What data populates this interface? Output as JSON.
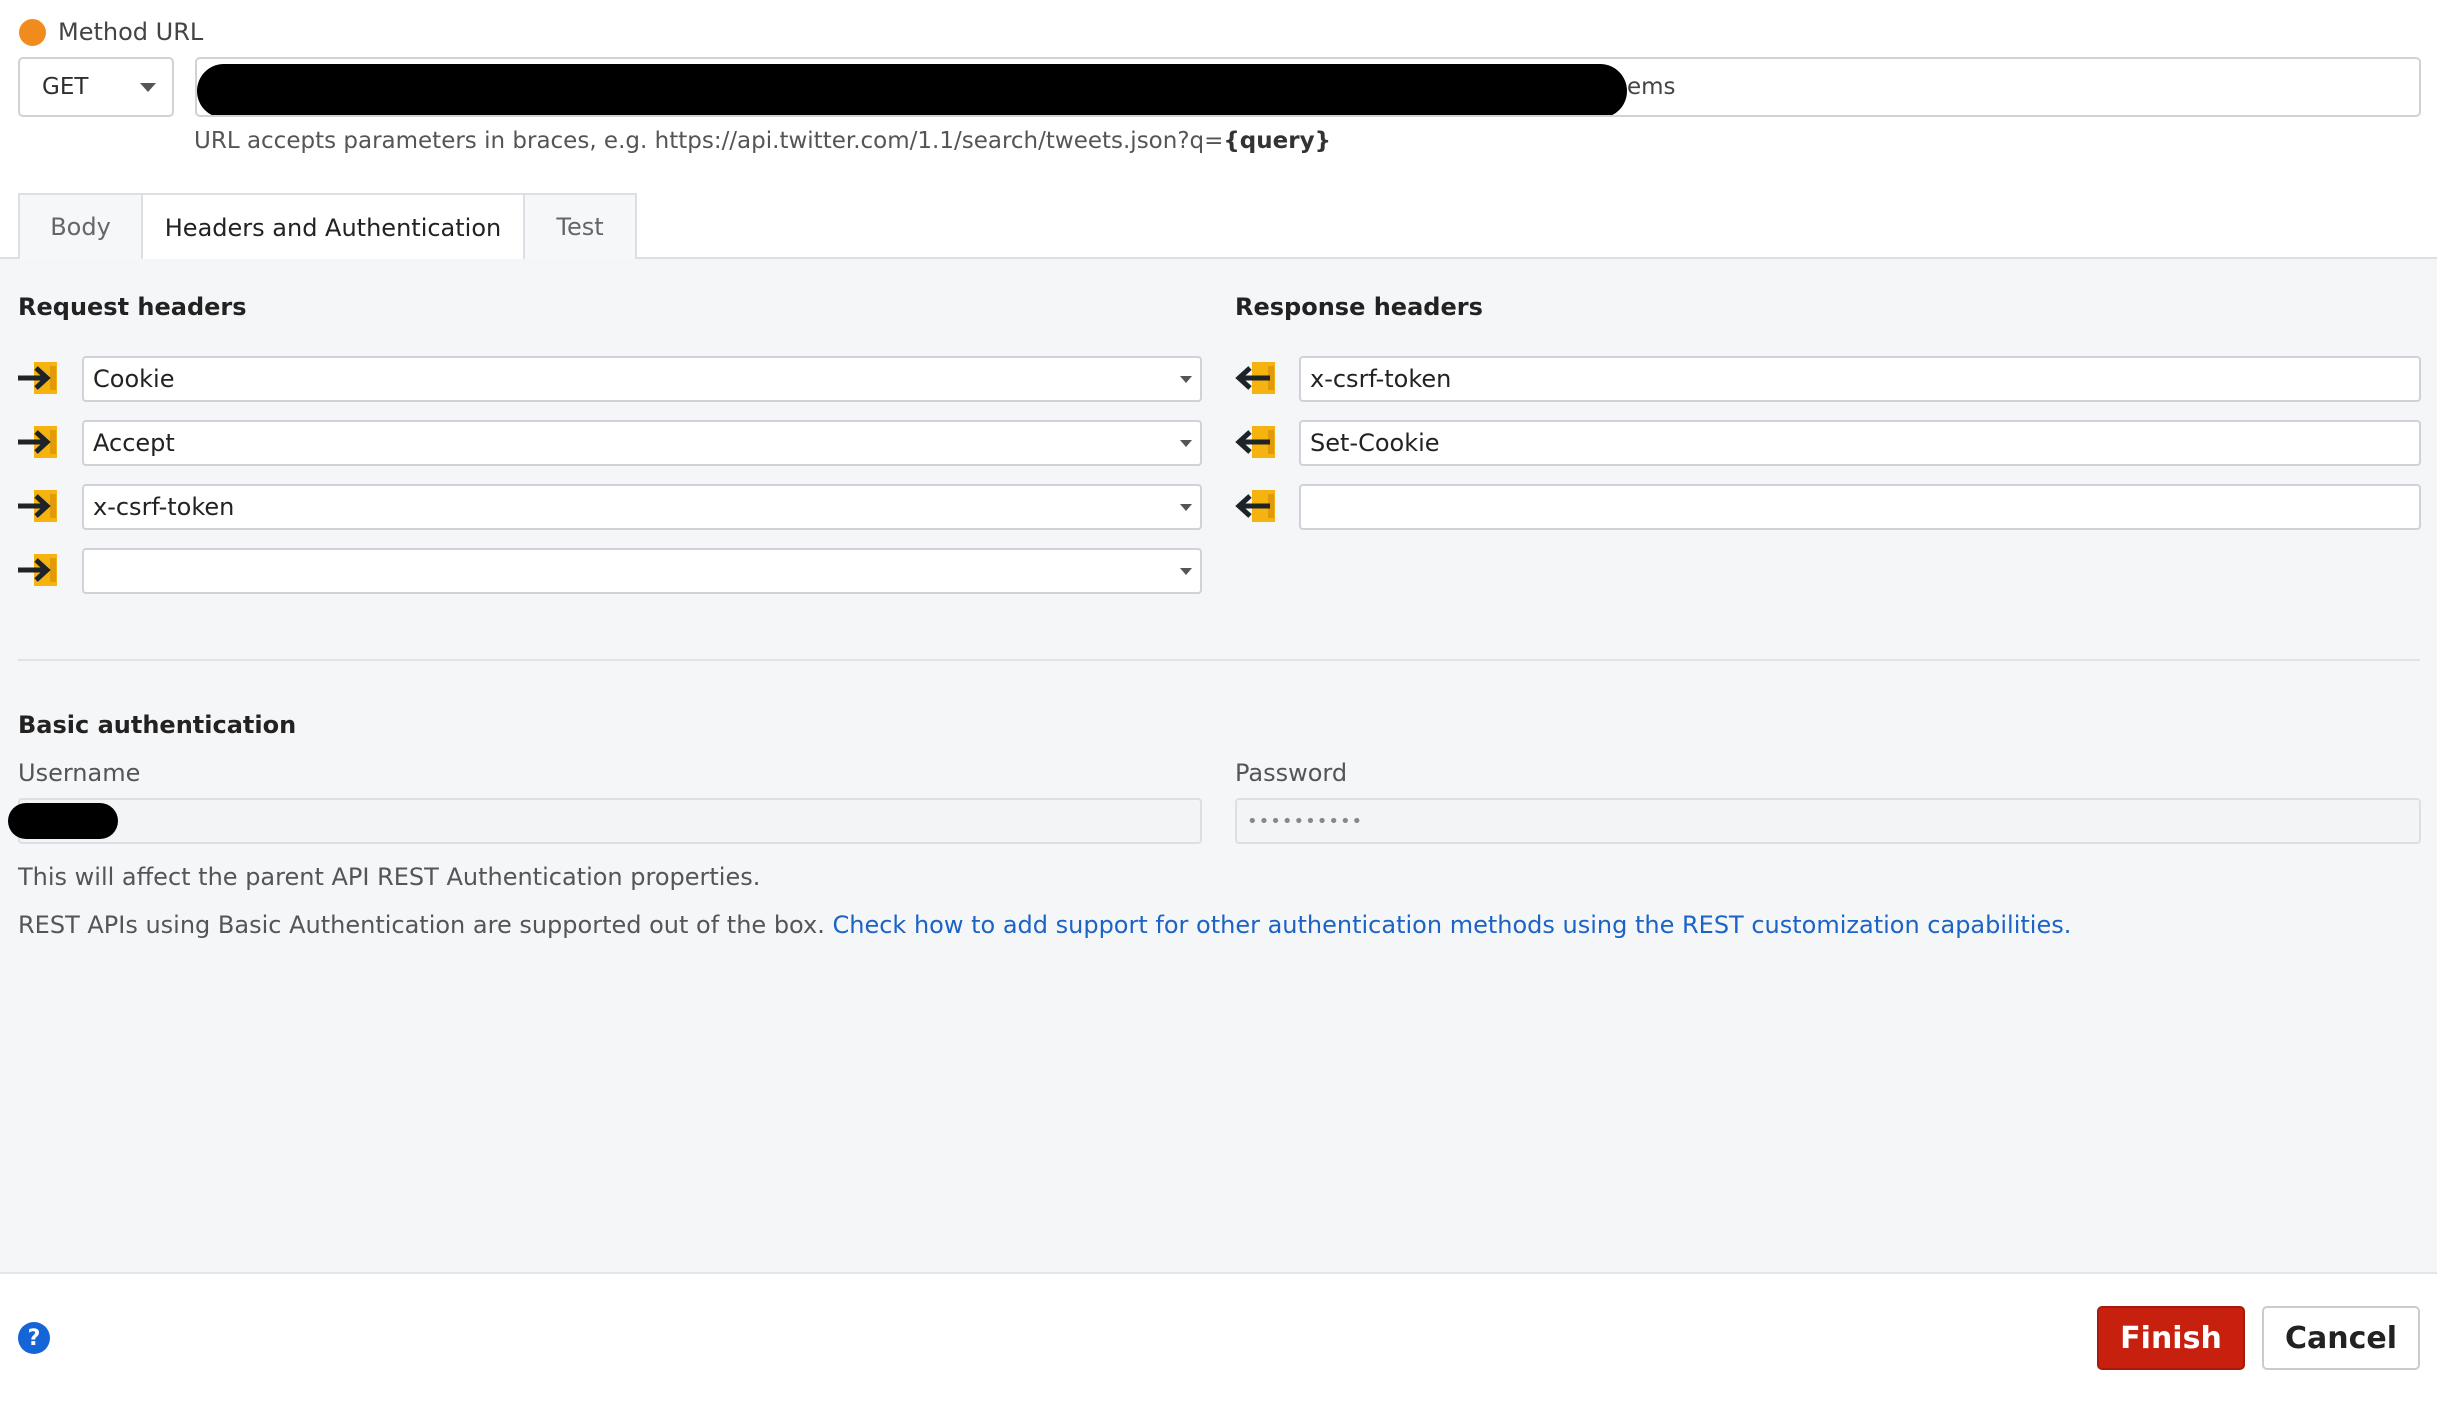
{
  "method_url": {
    "label": "Method URL",
    "method": "GET",
    "url_visible_suffix": "ems",
    "help_text": "URL accepts parameters in braces, e.g. https://api.twitter.com/1.1/search/tweets.json?q=",
    "help_param": "{query}"
  },
  "tabs": [
    {
      "label": "Body",
      "active": false
    },
    {
      "label": "Headers and Authentication",
      "active": true
    },
    {
      "label": "Test",
      "active": false
    }
  ],
  "request_headers": {
    "title": "Request headers",
    "items": [
      "Cookie",
      "Accept",
      "x-csrf-token",
      ""
    ]
  },
  "response_headers": {
    "title": "Response headers",
    "items": [
      "x-csrf-token",
      "Set-Cookie",
      ""
    ]
  },
  "basic_auth": {
    "title": "Basic authentication",
    "username_label": "Username",
    "password_label": "Password",
    "password_mask": "••••••••••",
    "note": "This will affect the parent API REST Authentication properties.",
    "support_text": "REST APIs using Basic Authentication are supported out of the box.",
    "support_link": "Check how to add support for other authentication methods using the REST customization capabilities."
  },
  "footer": {
    "help_icon": "?",
    "finish_label": "Finish",
    "cancel_label": "Cancel"
  },
  "colors": {
    "accent_orange": "#f28b1e",
    "header_icon_yellow": "#f5b30f",
    "finish_red": "#c8200e",
    "link_blue": "#1b63c4"
  }
}
